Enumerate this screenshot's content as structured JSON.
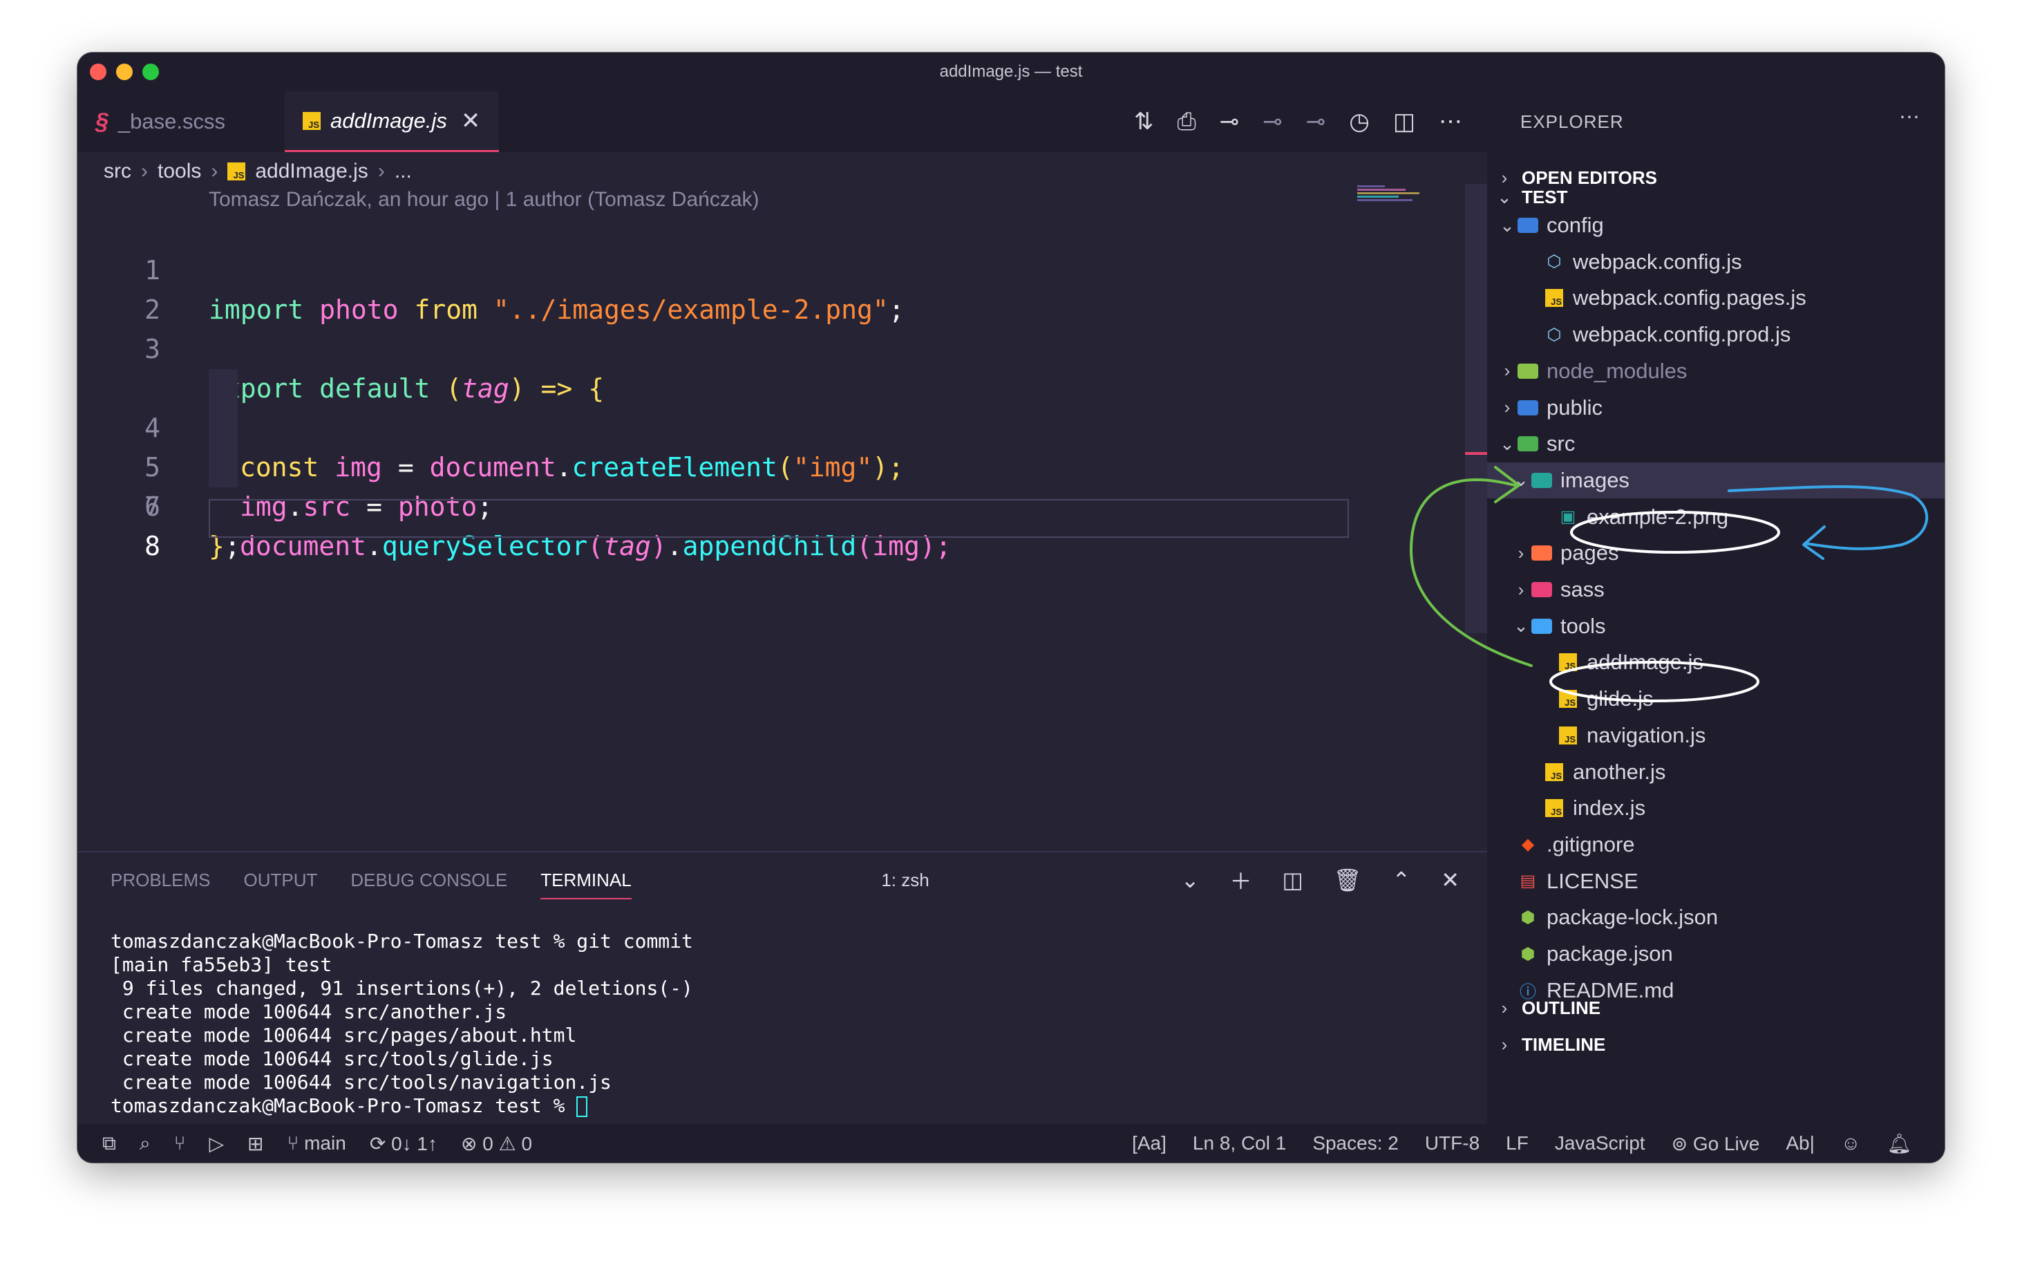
{
  "window": {
    "title": "addImage.js — test"
  },
  "tabs": [
    {
      "label": "_base.scss",
      "icon": "sass-icon"
    },
    {
      "label": "addImage.js",
      "icon": "js-icon",
      "active": true
    }
  ],
  "breadcrumb": [
    "src",
    "tools",
    "addImage.js",
    "..."
  ],
  "blame": "Tomasz Dańczak, an hour ago | 1 author (Tomasz Dańczak)",
  "code": {
    "line_numbers": [
      "1",
      "2",
      "3",
      "4",
      "5",
      "6",
      "7",
      "8"
    ],
    "l1": {
      "kw": "import",
      "id": "photo",
      "kw2": "from",
      "str": "\"../images/example-2.png\"",
      "end": ";"
    },
    "l3": {
      "kw": "export",
      "kw2": "default",
      "open": "(",
      "param": "tag",
      "close": ")",
      "arrow": "=>",
      "brace": "{"
    },
    "l4": {
      "kw": "const",
      "id": "img",
      "eq": "=",
      "obj": "document",
      "dot": ".",
      "fn": "createElement",
      "open": "(",
      "str": "\"img\"",
      "close": ");"
    },
    "l5": {
      "obj": "img",
      "dot": ".",
      "prop": "src",
      "eq": "=",
      "val": "photo",
      "end": ";"
    },
    "l6": {
      "obj": "document",
      "dot": ".",
      "fn": "querySelector",
      "open": "(",
      "param": "tag",
      "close": ")",
      "dot2": ".",
      "fn2": "appendChild",
      "open2": "(",
      "arg": "img",
      "close2": ");"
    },
    "l7": {
      "brace": "}",
      "end": ";"
    }
  },
  "panel": {
    "tabs": [
      "PROBLEMS",
      "OUTPUT",
      "DEBUG CONSOLE",
      "TERMINAL"
    ],
    "terminal_select": "1: zsh",
    "terminal_lines": [
      "tomaszdanczak@MacBook-Pro-Tomasz test % git commit",
      "[main fa55eb3] test",
      " 9 files changed, 91 insertions(+), 2 deletions(-)",
      " create mode 100644 src/another.js",
      " create mode 100644 src/pages/about.html",
      " create mode 100644 src/tools/glide.js",
      " create mode 100644 src/tools/navigation.js"
    ],
    "prompt": "tomaszdanczak@MacBook-Pro-Tomasz test % "
  },
  "explorer": {
    "title": "EXPLORER",
    "sections": {
      "open_editors": "OPEN EDITORS",
      "test": "TEST",
      "outline": "OUTLINE",
      "timeline": "TIMELINE"
    },
    "tree": [
      {
        "label": "config",
        "type": "folder-open",
        "depth": 1,
        "icon": "config-folder-icon"
      },
      {
        "label": "webpack.config.js",
        "type": "file",
        "depth": 2,
        "icon": "webpack-icon"
      },
      {
        "label": "webpack.config.pages.js",
        "type": "file",
        "depth": 2,
        "icon": "js-icon"
      },
      {
        "label": "webpack.config.prod.js",
        "type": "file",
        "depth": 2,
        "icon": "webpack-icon"
      },
      {
        "label": "node_modules",
        "type": "folder",
        "depth": 1,
        "icon": "node-folder-icon",
        "dim": true
      },
      {
        "label": "public",
        "type": "folder",
        "depth": 1,
        "icon": "public-folder-icon"
      },
      {
        "label": "src",
        "type": "folder-open",
        "depth": 1,
        "icon": "src-folder-icon"
      },
      {
        "label": "images",
        "type": "folder-open",
        "depth": 2,
        "icon": "images-folder-icon",
        "selected": true
      },
      {
        "label": "example-2.png",
        "type": "file",
        "depth": 3,
        "icon": "image-file-icon"
      },
      {
        "label": "pages",
        "type": "folder",
        "depth": 2,
        "icon": "pages-folder-icon"
      },
      {
        "label": "sass",
        "type": "folder",
        "depth": 2,
        "icon": "sass-folder-icon"
      },
      {
        "label": "tools",
        "type": "folder-open",
        "depth": 2,
        "icon": "tools-folder-icon"
      },
      {
        "label": "addImage.js",
        "type": "file",
        "depth": 3,
        "icon": "js-icon"
      },
      {
        "label": "glide.js",
        "type": "file",
        "depth": 3,
        "icon": "js-icon"
      },
      {
        "label": "navigation.js",
        "type": "file",
        "depth": 3,
        "icon": "js-icon"
      },
      {
        "label": "another.js",
        "type": "file",
        "depth": 2,
        "icon": "js-icon"
      },
      {
        "label": "index.js",
        "type": "file",
        "depth": 2,
        "icon": "js-icon"
      },
      {
        "label": ".gitignore",
        "type": "file",
        "depth": 1,
        "icon": "git-icon"
      },
      {
        "label": "LICENSE",
        "type": "file",
        "depth": 1,
        "icon": "license-icon"
      },
      {
        "label": "package-lock.json",
        "type": "file",
        "depth": 1,
        "icon": "node-icon"
      },
      {
        "label": "package.json",
        "type": "file",
        "depth": 1,
        "icon": "node-icon"
      },
      {
        "label": "README.md",
        "type": "file",
        "depth": 1,
        "icon": "info-icon"
      }
    ]
  },
  "statusbar": {
    "branch": "main",
    "sync": "0↓ 1↑",
    "errors": "0",
    "warnings": "0",
    "case": "[Aa]",
    "position": "Ln 8, Col 1",
    "spaces": "Spaces: 2",
    "encoding": "UTF-8",
    "eol": "LF",
    "language": "JavaScript",
    "golive": "Go Live",
    "abl": "Ab|"
  },
  "colors": {
    "accent": "#e8436d",
    "bg": "#262335",
    "sidebar": "#1f1d2c",
    "annotation_green": "#6fc24a",
    "annotation_blue": "#3aa7e8"
  }
}
